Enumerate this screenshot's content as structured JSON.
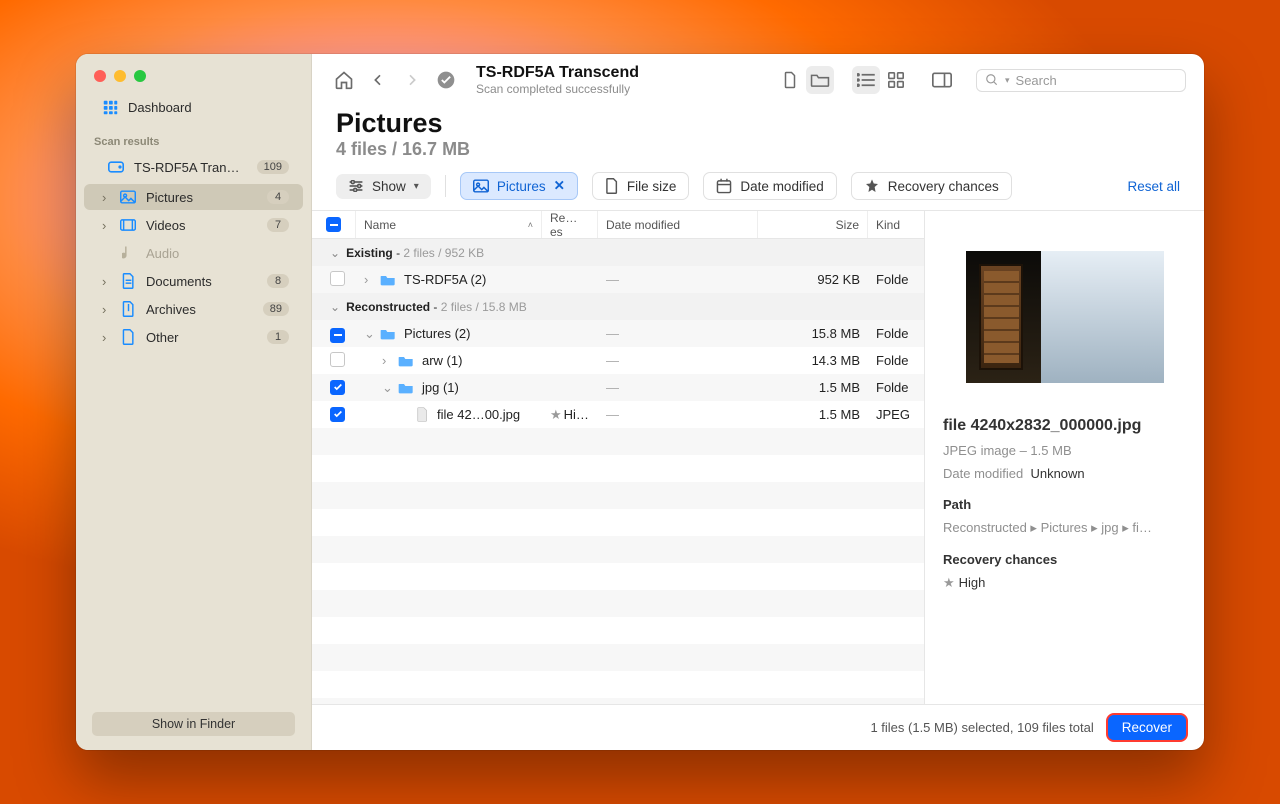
{
  "window": {
    "title": "TS-RDF5A Transcend",
    "subtitle": "Scan completed successfully"
  },
  "search": {
    "placeholder": "Search"
  },
  "sidebar": {
    "dashboard": "Dashboard",
    "section": "Scan results",
    "drive": {
      "label": "TS-RDF5A Transc…",
      "badge": "109"
    },
    "items": [
      {
        "label": "Pictures",
        "badge": "4",
        "selected": true
      },
      {
        "label": "Videos",
        "badge": "7"
      },
      {
        "label": "Audio",
        "badge": "",
        "disabled": true
      },
      {
        "label": "Documents",
        "badge": "8"
      },
      {
        "label": "Archives",
        "badge": "89"
      },
      {
        "label": "Other",
        "badge": "1"
      }
    ],
    "show_in_finder": "Show in Finder"
  },
  "heading": {
    "title": "Pictures",
    "summary": "4 files / 16.7 MB"
  },
  "filters": {
    "show": "Show",
    "pictures": "Pictures",
    "filesize": "File size",
    "date": "Date modified",
    "recovery": "Recovery chances",
    "reset": "Reset all"
  },
  "columns": {
    "name": "Name",
    "re": "Re…es",
    "date": "Date modified",
    "size": "Size",
    "kind": "Kind"
  },
  "groups": [
    {
      "label": "Existing",
      "meta": "2 files / 952 KB"
    },
    {
      "label": "Reconstructed",
      "meta": "2 files / 15.8 MB"
    }
  ],
  "rows": [
    {
      "cb": "off",
      "depth": 0,
      "expand": "closed",
      "icon": "folder",
      "name": "TS-RDF5A (2)",
      "re": "",
      "date": "—",
      "size": "952 KB",
      "kind": "Folde"
    },
    {
      "cb": "mix",
      "depth": 0,
      "expand": "open",
      "icon": "folder",
      "name": "Pictures (2)",
      "re": "",
      "date": "—",
      "size": "15.8 MB",
      "kind": "Folde"
    },
    {
      "cb": "off",
      "depth": 1,
      "expand": "closed",
      "icon": "folder",
      "name": "arw (1)",
      "re": "",
      "date": "—",
      "size": "14.3 MB",
      "kind": "Folde"
    },
    {
      "cb": "on",
      "depth": 1,
      "expand": "open",
      "icon": "folder",
      "name": "jpg (1)",
      "re": "",
      "date": "—",
      "size": "1.5 MB",
      "kind": "Folde"
    },
    {
      "cb": "on",
      "depth": 2,
      "expand": "none",
      "icon": "file",
      "name": "file 42…00.jpg",
      "re": "Hi…",
      "date": "—",
      "size": "1.5 MB",
      "kind": "JPEG"
    }
  ],
  "details": {
    "filename": "file 4240x2832_000000.jpg",
    "meta": "JPEG image – 1.5 MB",
    "date_lbl": "Date modified",
    "date_val": "Unknown",
    "path_lbl": "Path",
    "path_val": "Reconstructed ▸ Pictures ▸ jpg ▸ fi…",
    "rc_lbl": "Recovery chances",
    "rc_val": "High"
  },
  "footer": {
    "status": "1 files (1.5 MB) selected, 109 files total",
    "recover": "Recover"
  }
}
